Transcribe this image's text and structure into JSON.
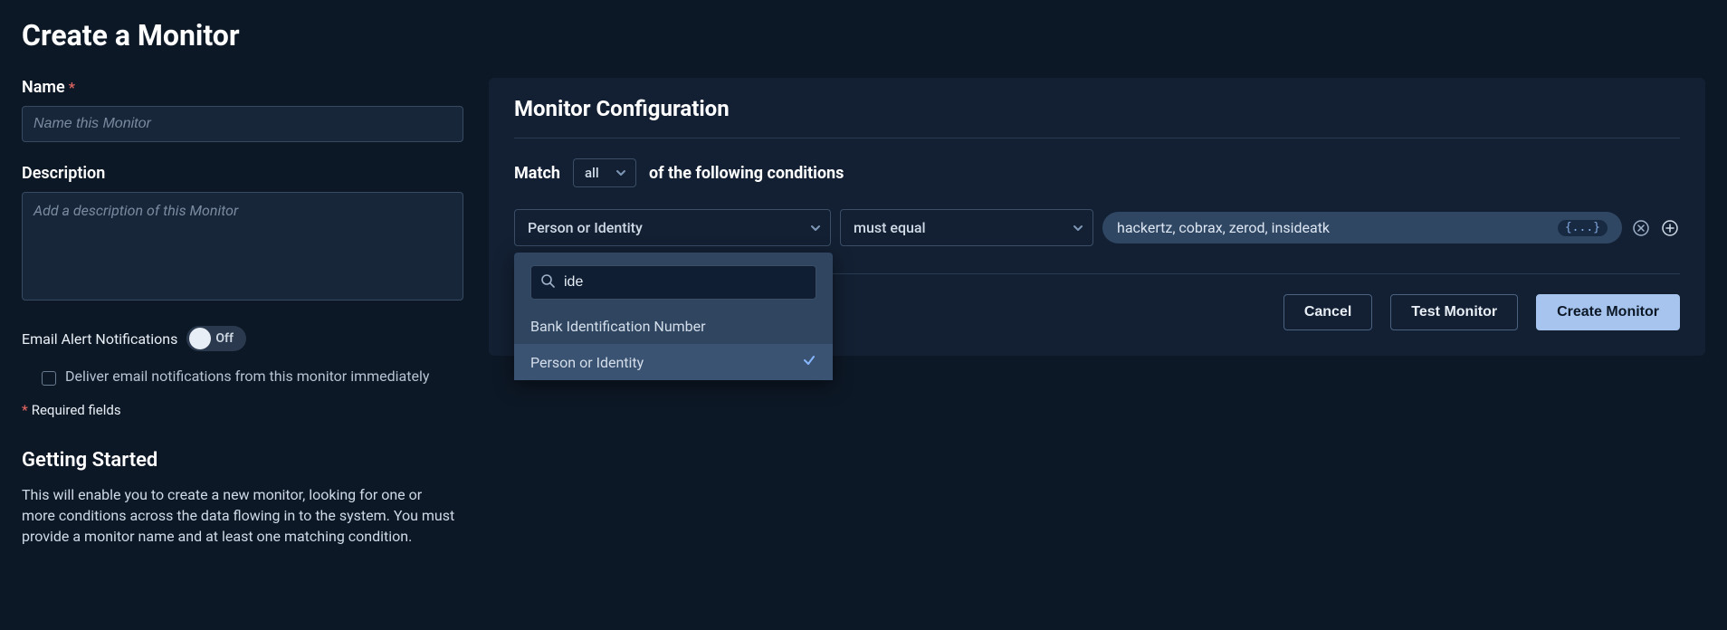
{
  "page_title": "Create a Monitor",
  "left": {
    "name_label": "Name",
    "name_placeholder": "Name this Monitor",
    "desc_label": "Description",
    "desc_placeholder": "Add a description of this Monitor",
    "email_alert_label": "Email Alert Notifications",
    "toggle_state": "Off",
    "deliver_label": "Deliver email notifications from this monitor immediately",
    "required_note": "Required fields",
    "getting_started_title": "Getting Started",
    "getting_started_body": "This will enable you to create a new monitor, looking for one or more conditions across the data flowing in to the system. You must provide a monitor name and at least one matching condition."
  },
  "config": {
    "title": "Monitor Configuration",
    "match_prefix": "Match",
    "match_mode": "all",
    "match_suffix": "of the following conditions",
    "condition": {
      "field": "Person or Identity",
      "operator": "must equal",
      "value": "hackertz, cobrax, zerod, insideatk",
      "value_badge": "{...}"
    },
    "dropdown": {
      "search_value": "ide",
      "options": [
        {
          "label": "Bank Identification Number",
          "selected": false
        },
        {
          "label": "Person or Identity",
          "selected": true
        }
      ]
    },
    "buttons": {
      "cancel": "Cancel",
      "test": "Test Monitor",
      "create": "Create Monitor"
    }
  }
}
